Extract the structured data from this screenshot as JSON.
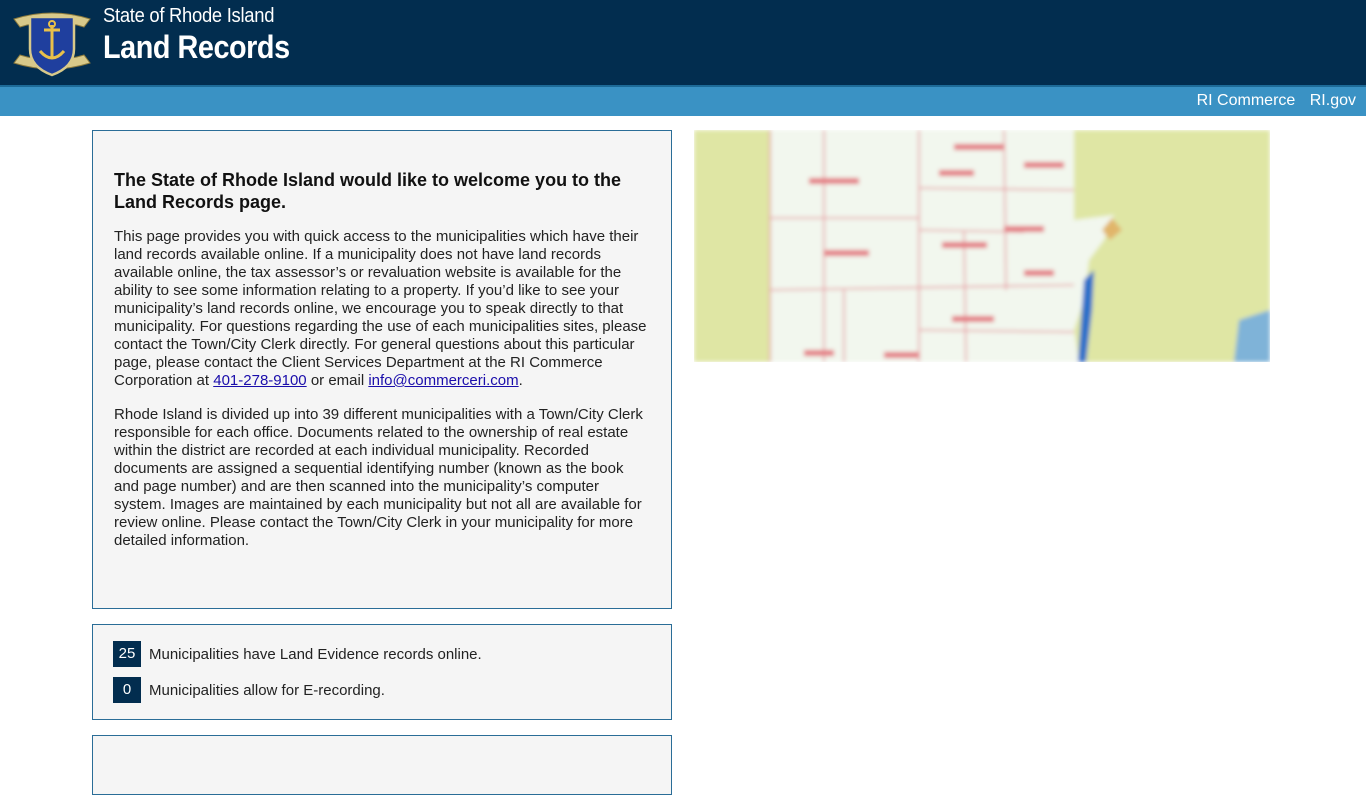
{
  "header": {
    "title_small": "State of Rhode Island",
    "title_big": "Land Records"
  },
  "subnav": {
    "links": [
      "RI Commerce",
      "RI.gov"
    ]
  },
  "intro": {
    "heading": "The State of Rhode Island would like to welcome you to the Land Records page.",
    "p1_a": "This page provides you with quick access to the municipalities which have their land records available online. If a municipality does not have land records available online, the tax assessor’s or revaluation website is available for the ability to see some information relating to a property. If you’d like to see your municipality’s land records online, we encourage you to speak directly to that municipality. For questions regarding the use of each municipalities sites, please contact the Town/City Clerk directly. For general questions about this particular page, please contact the Client Services Department at the RI Commerce Corporation at ",
    "phone": "401-278-9100",
    "p1_b": " or email ",
    "email": "info@commerceri.com",
    "p1_c": ".",
    "p2": "Rhode Island is divided up into 39 different municipalities with a Town/City Clerk responsible for each office. Documents related to the ownership of real estate within the district are recorded at each individual municipality. Recorded documents are assigned a sequential identifying number (known as the book and page number) and are then scanned into the municipality’s computer system. Images are maintained by each municipality but not all are available for review online. Please contact the Town/City Clerk in your municipality for more detailed information."
  },
  "stats": [
    {
      "count": "25",
      "text": "Municipalities have Land Evidence records online."
    },
    {
      "count": "0",
      "text": "Municipalities allow for E-recording."
    }
  ],
  "colors": {
    "header_bg": "#022d4f",
    "subbar_bg": "#3a92c4",
    "panel_border": "#2a6d97",
    "badge_bg": "#022d4f"
  },
  "icons": {
    "seal": "state-seal-icon",
    "map": "municipality-map-image"
  }
}
